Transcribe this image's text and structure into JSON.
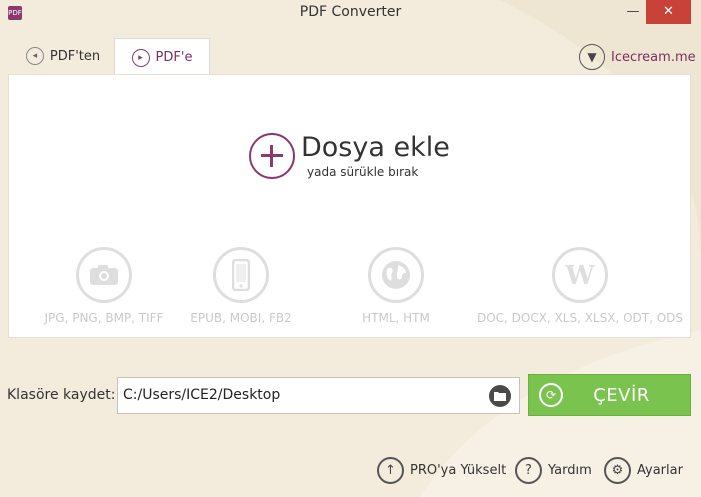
{
  "window": {
    "title": "PDF Converter",
    "icon_text": "PDF",
    "minimize_glyph": "—",
    "close_glyph": "✕"
  },
  "tabs": [
    {
      "label": "PDF'ten",
      "icon": "pdf-from-icon",
      "active": false
    },
    {
      "label": "PDF'e",
      "icon": "pdf-to-icon",
      "active": true
    }
  ],
  "brand": {
    "label": "Icecream.me",
    "icon": "icecream-icon"
  },
  "main": {
    "add_title": "Dosya ekle",
    "add_subtitle": "yada sürükle bırak",
    "formats": [
      {
        "label": "JPG, PNG, BMP, TIFF",
        "icon": "camera-icon"
      },
      {
        "label": "EPUB, MOBI, FB2",
        "icon": "phone-icon"
      },
      {
        "label": "HTML, HTM",
        "icon": "globe-icon"
      },
      {
        "label": "DOC, DOCX, XLS, XLSX, ODT, ODS",
        "icon": "word-icon"
      }
    ]
  },
  "save": {
    "label": "Klasöre kaydet:",
    "path": "C:/Users/ICE2/Desktop",
    "browse_icon": "folder-icon"
  },
  "convert": {
    "label": "ÇEVİR",
    "icon": "refresh-icon"
  },
  "footer": {
    "upgrade_label": "PRO'ya Yükselt",
    "help_label": "Yardım",
    "settings_label": "Ayarlar"
  },
  "colors": {
    "accent": "#8a3a6e",
    "convert": "#7bc34f",
    "background": "#f3ecdd",
    "close": "#c9423a"
  }
}
